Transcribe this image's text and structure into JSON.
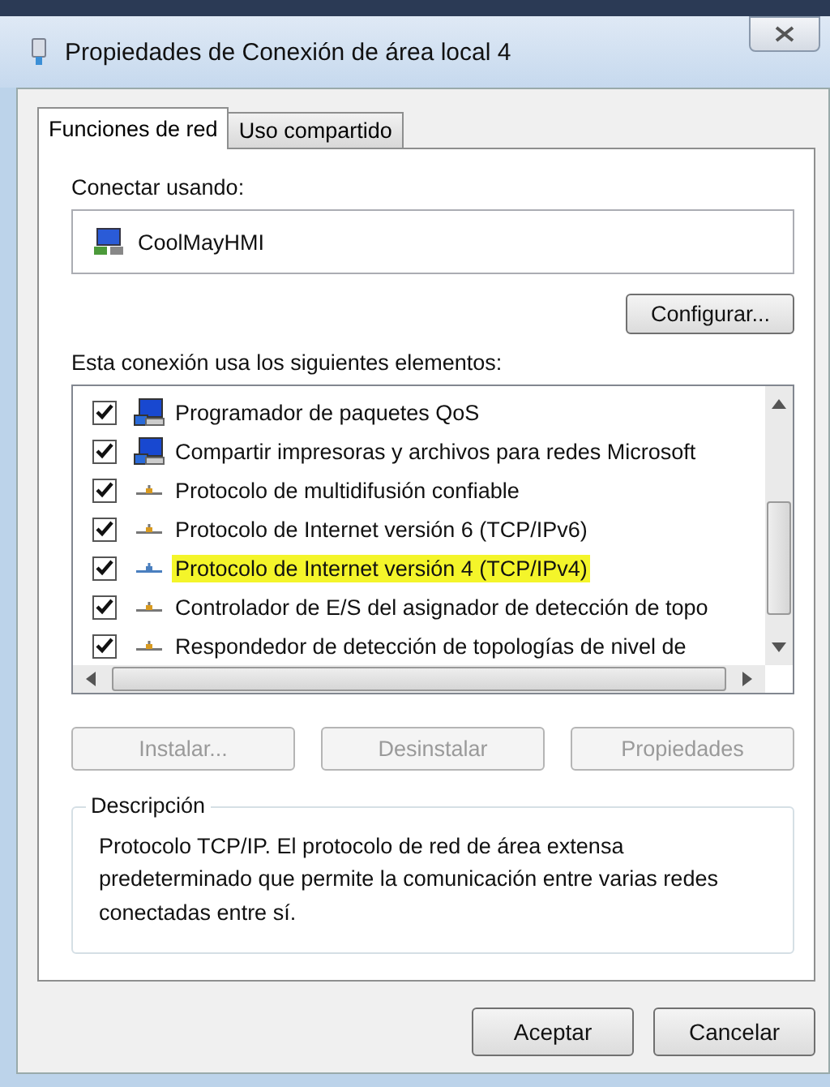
{
  "window": {
    "title": "Propiedades de Conexión de área local 4"
  },
  "tabs": [
    {
      "label": "Funciones de red",
      "selected": true
    },
    {
      "label": "Uso compartido",
      "selected": false
    }
  ],
  "connect_using": {
    "label": "Conectar usando:",
    "adapter": "CoolMayHMI",
    "button": "Configurar..."
  },
  "components": {
    "label": "Esta conexión usa los siguientes elementos:",
    "items": [
      {
        "kind": "service",
        "label": "Programador de paquetes QoS",
        "checked": true,
        "highlighted": false
      },
      {
        "kind": "service",
        "label": "Compartir impresoras y archivos para redes Microsoft",
        "checked": true,
        "highlighted": false
      },
      {
        "kind": "protocol",
        "label": "Protocolo de multidifusión confiable",
        "checked": true,
        "highlighted": false
      },
      {
        "kind": "protocol",
        "label": "Protocolo de Internet versión 6 (TCP/IPv6)",
        "checked": true,
        "highlighted": false
      },
      {
        "kind": "protocol",
        "label": "Protocolo de Internet versión 4 (TCP/IPv4)",
        "checked": true,
        "highlighted": true
      },
      {
        "kind": "protocol",
        "label": "Controlador de E/S del asignador de detección de topo",
        "checked": true,
        "highlighted": false
      },
      {
        "kind": "protocol",
        "label": "Respondedor de detección de topologías de nivel de",
        "checked": true,
        "highlighted": false
      }
    ]
  },
  "item_buttons": [
    {
      "label": "Instalar...",
      "disabled": true
    },
    {
      "label": "Desinstalar",
      "disabled": true
    },
    {
      "label": "Propiedades",
      "disabled": true
    }
  ],
  "description": {
    "title": "Descripción",
    "text": "Protocolo TCP/IP. El protocolo de red de área extensa predeterminado que permite la comunicación entre varias redes conectadas entre sí."
  },
  "buttons": [
    "Aceptar",
    "Cancelar"
  ]
}
